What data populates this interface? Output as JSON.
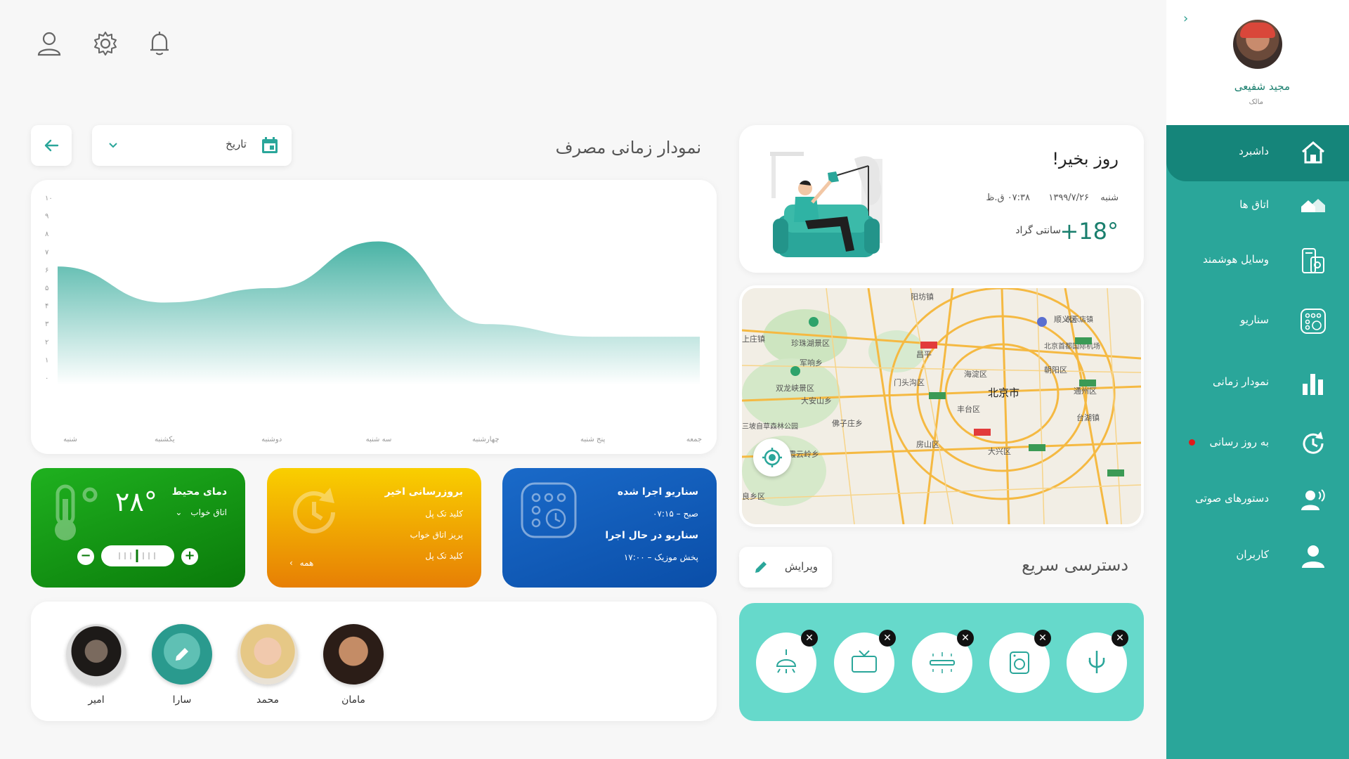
{
  "colors": {
    "accent": "#2aa69a",
    "accent_dark": "#15857a",
    "quick_bg": "#66d9cb"
  },
  "profile": {
    "name": "مجید شفیعی",
    "role": "مالک"
  },
  "nav": {
    "items": [
      {
        "label": "داشبرد",
        "icon": "home-icon"
      },
      {
        "label": "اتاق ها",
        "icon": "rooms-icon"
      },
      {
        "label": "وسایل هوشمند",
        "icon": "smart-devices-icon"
      },
      {
        "label": "سناریو",
        "icon": "scenario-icon"
      },
      {
        "label": "نمودار زمانی",
        "icon": "bar-chart-icon"
      },
      {
        "label": "به روز رسانی",
        "icon": "update-icon"
      },
      {
        "label": "دستورهای صوتی",
        "icon": "voice-command-icon"
      },
      {
        "label": "کاربران",
        "icon": "users-icon"
      }
    ]
  },
  "header": {
    "icons": [
      "user-icon",
      "gear-icon",
      "bell-icon"
    ]
  },
  "usage": {
    "title": "نمودار زمانی مصرف",
    "date_label": "تاریخ"
  },
  "chart_data": {
    "type": "area",
    "categories": [
      "شنبه",
      "یکشنبه",
      "دوشنبه",
      "سه شنبه",
      "چهارشنبه",
      "پنج شنبه",
      "جمعه"
    ],
    "y_ticks": [
      "۰",
      "۱",
      "۲",
      "۳",
      "۴",
      "۵",
      "۶",
      "۷",
      "۸",
      "۹",
      "۱۰"
    ],
    "values": [
      6.2,
      4.2,
      5.0,
      7.6,
      3.0,
      2.3,
      2.3
    ],
    "ylim": [
      0,
      10
    ]
  },
  "welcome": {
    "greeting": "روز بخیر!",
    "day": "شنبه",
    "date": "۱۳۹۹/۷/۲۶",
    "time": "۰۷:۳۸ ق.ظ",
    "temperature": "+18°",
    "unit": "سانتی گراد"
  },
  "map": {
    "labels": [
      "北京市",
      "朝阳区",
      "海淀区",
      "丰台区",
      "通州区",
      "大兴区",
      "房山区",
      "门头沟区",
      "顺义区",
      "北京首都国际机场",
      "昌平",
      "台湖镇",
      "双龙峡景区",
      "珍珠湖景区",
      "大安山乡",
      "霞云岭乡",
      "军响乡",
      "佛子庄乡",
      "阳坊镇",
      "三坡自草森林公园",
      "上庄镇",
      "永乐店镇",
      "良乡区"
    ]
  },
  "tiles": {
    "scenario": {
      "title": "سناریو اجرا شده",
      "line1": "صبح – ۰۷:۱۵",
      "title2": "سناریو در حال اجرا",
      "line2": "پخش موزیک – ۱۷:۰۰"
    },
    "updates": {
      "title": "بروزرسانی اخیر",
      "items": [
        "کلید تک پل",
        "پریز اتاق خواب",
        "کلید تک پل"
      ],
      "more": "همه"
    },
    "temperature": {
      "title": "دمای محیط",
      "room": "اتاق خواب",
      "value": "۲۸°"
    }
  },
  "quick_access": {
    "title": "دسترسی سریع",
    "edit_label": "ویرایش"
  },
  "members": [
    "مامان",
    "محمد",
    "سارا",
    "امیر"
  ]
}
